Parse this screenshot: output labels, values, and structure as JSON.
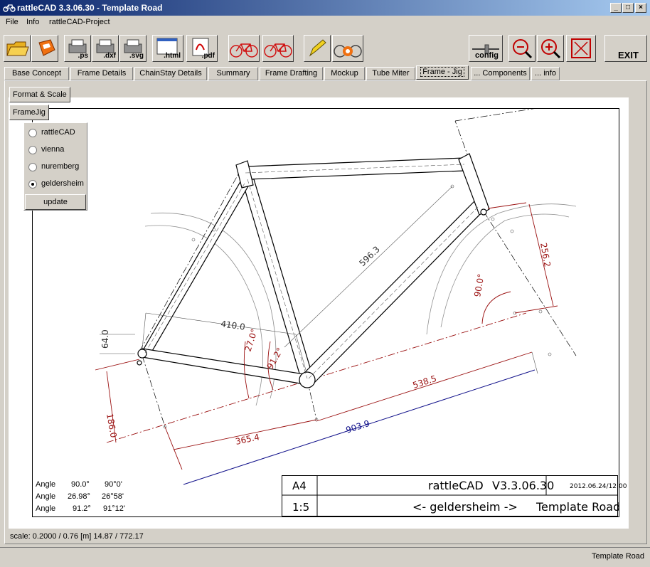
{
  "window": {
    "title": "rattleCAD  3.3.06.30 - Template Road"
  },
  "menu": [
    "File",
    "Info",
    "rattleCAD-Project"
  ],
  "toolbar": {
    "export_ps": ".ps",
    "export_dxf": ".dxf",
    "export_svg": ".svg",
    "export_html": ".html",
    "export_pdf": ".pdf",
    "config": "config",
    "exit": "EXIT"
  },
  "tabs": [
    "Base Concept",
    "Frame Details",
    "ChainStay Details",
    "Summary",
    "Frame Drafting",
    "Mockup",
    "Tube Miter",
    "Frame - Jig",
    "... Components",
    "... info"
  ],
  "active_tab": "Frame - Jig",
  "side_buttons": {
    "format_scale": "Format & Scale",
    "framejig": "FrameJig"
  },
  "jig_options": [
    {
      "label": "rattleCAD",
      "selected": false
    },
    {
      "label": "vienna",
      "selected": false
    },
    {
      "label": "nuremberg",
      "selected": false
    },
    {
      "label": "geldersheim",
      "selected": true
    }
  ],
  "update_label": "update",
  "dimensions": {
    "d596": "596.3",
    "d410": "410.0",
    "d64": "64.0",
    "d186": "186.0",
    "d365": "365.4",
    "d903": "903.9",
    "d538": "538.5",
    "d256": "256.2",
    "a90": "90.0°",
    "a270": "27.0°",
    "a912": "91.2°"
  },
  "angles": [
    {
      "label": "Angle",
      "deg": "90.0°",
      "dms": "90°0'"
    },
    {
      "label": "Angle",
      "deg": "26.98°",
      "dms": "26°58'"
    },
    {
      "label": "Angle",
      "deg": "91.2°",
      "dms": "91°12'"
    }
  ],
  "title_block": {
    "format": "A4",
    "app": "rattleCAD",
    "version": "V3.3.06.30",
    "date": "2012.06.24/12:00",
    "scale": "1:5",
    "jig": "<- geldersheim ->",
    "project": "Template Road"
  },
  "scale_readout": "scale: 0.2000 / 0.76  [m]  14.87 / 772.17",
  "status": "Template Road",
  "colors": {
    "dim": "#9a1010",
    "dim_blue": "#10108a",
    "titlebar": "#0a246a"
  }
}
